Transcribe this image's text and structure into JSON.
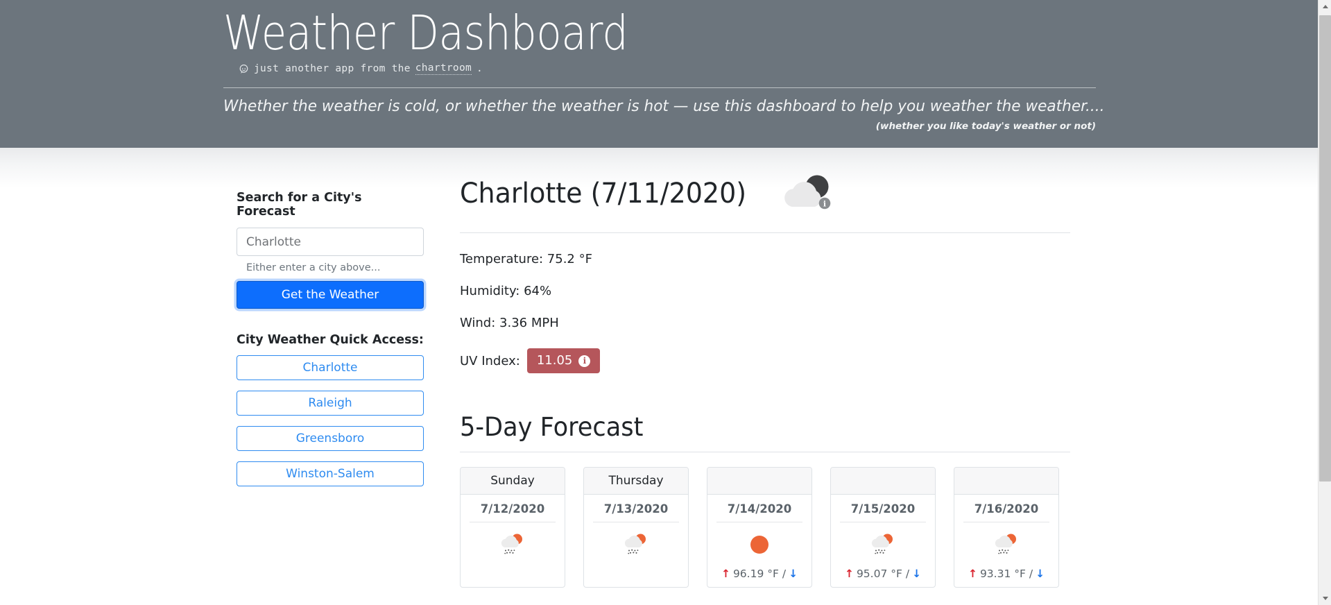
{
  "header": {
    "title": "Weather Dashboard",
    "byline_prefix": "just another app from the",
    "byline_link": "chartroom",
    "byline_suffix": ".",
    "byline_icon": "chat-bubble-icon",
    "tagline": "Whether the weather is cold, or whether the weather is hot — use this dashboard to help you weather the weather....",
    "tagline_sub": "(whether you like today's weather or not)",
    "bg_color": "#6c757d"
  },
  "sidebar": {
    "search_title": "Search for a City's Forecast",
    "search_value": "Charlotte",
    "search_placeholder": "Charlotte",
    "helper_text": "Either enter a city above...",
    "submit_label": "Get the Weather",
    "submit_color": "#0d6efd",
    "quick_title": "City Weather Quick Access:",
    "quick_cities": [
      {
        "label": "Charlotte"
      },
      {
        "label": "Raleigh"
      },
      {
        "label": "Greensboro"
      },
      {
        "label": "Winston-Salem"
      }
    ],
    "quick_color": "#2e8bf0"
  },
  "current": {
    "heading": "Charlotte (7/11/2020)",
    "icon": "broken-clouds-icon",
    "temperature": "Temperature: 75.2 °F",
    "humidity": "Humidity: 64%",
    "wind": "Wind: 3.36 MPH",
    "uv_label": "UV Index:",
    "uv_value": "11.05",
    "uv_badge_color": "#b5565b",
    "uv_info_icon": "info-icon"
  },
  "forecast": {
    "title": "5-Day Forecast",
    "cards": [
      {
        "day": "Sunday",
        "date": "7/12/2020",
        "icon": "rain-with-sun-icon",
        "temp_high": "",
        "temp_text": ""
      },
      {
        "day": "Thursday",
        "date": "7/13/2020",
        "icon": "rain-with-sun-icon",
        "temp_high": "",
        "temp_text": ""
      },
      {
        "day": "",
        "date": "7/14/2020",
        "icon": "clear-sun-icon",
        "temp_high": "96.19 °F",
        "temp_text": "96.19 °F /"
      },
      {
        "day": "",
        "date": "7/15/2020",
        "icon": "rain-with-sun-icon",
        "temp_high": "95.07 °F",
        "temp_text": "95.07 °F /"
      },
      {
        "day": "",
        "date": "7/16/2020",
        "icon": "rain-with-sun-icon",
        "temp_high": "93.31 °F",
        "temp_text": "93.31 °F /"
      }
    ],
    "arrow_up_icon": "arrow-up-icon",
    "arrow_down_icon": "arrow-down-icon",
    "arrow_up_color": "#d9232e",
    "arrow_down_color": "#1a73e8"
  },
  "scrollbar": {
    "up_icon": "scroll-up-arrow-icon",
    "down_icon": "scroll-down-arrow-icon"
  }
}
